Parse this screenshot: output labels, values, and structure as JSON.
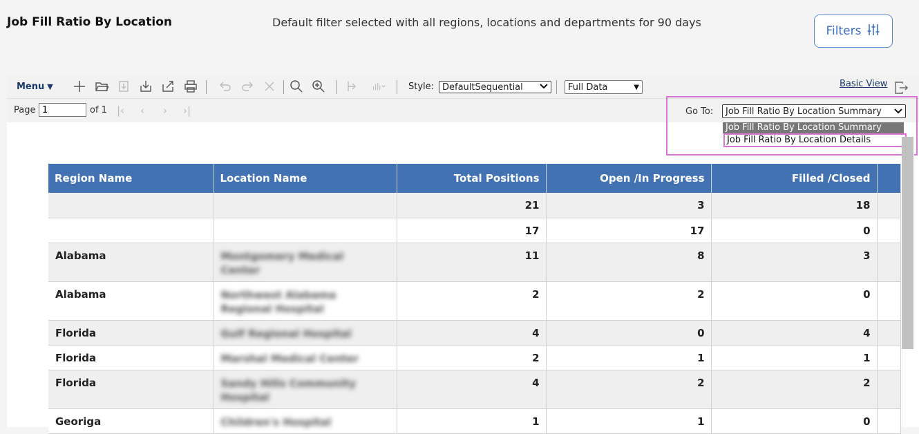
{
  "header": {
    "title": "Job Fill Ratio By Location",
    "subtitle": "Default filter selected with all regions, locations and departments for 90 days",
    "filters_label": "Filters"
  },
  "toolbar": {
    "menu_label": "Menu",
    "style_label": "Style:",
    "style_value": "DefaultSequential",
    "data_value": "Full Data",
    "basic_view_label": "Basic View"
  },
  "pager": {
    "page_label": "Page",
    "page_value": "1",
    "of_label": "of 1"
  },
  "goto": {
    "label": "Go To:",
    "selected": "Job Fill Ratio By Location Summary",
    "options": [
      "Job Fill Ratio By Location Summary",
      "Job Fill Ratio By Location Details"
    ]
  },
  "table": {
    "columns": [
      "Region Name",
      "Location Name",
      "Total Positions",
      "Open /In Progress",
      "Filled /Closed"
    ],
    "rows": [
      {
        "region": "",
        "location": "",
        "total": "21",
        "open": "3",
        "filled": "18"
      },
      {
        "region": "",
        "location": "",
        "total": "17",
        "open": "17",
        "filled": "0"
      },
      {
        "region": "Alabama",
        "location": "Montgomery Medical Center",
        "total": "11",
        "open": "8",
        "filled": "3"
      },
      {
        "region": "Alabama",
        "location": "Northwest Alabama Regional Hospital",
        "total": "2",
        "open": "2",
        "filled": "0"
      },
      {
        "region": "Florida",
        "location": "Gulf Regional Hospital",
        "total": "4",
        "open": "0",
        "filled": "4"
      },
      {
        "region": "Florida",
        "location": "Marshal Medical Center",
        "total": "2",
        "open": "1",
        "filled": "1"
      },
      {
        "region": "Florida",
        "location": "Sandy Hills Community Hospital",
        "total": "4",
        "open": "2",
        "filled": "2"
      },
      {
        "region": "Georiga",
        "location": "Children's Hospital",
        "total": "1",
        "open": "1",
        "filled": "0"
      }
    ]
  },
  "colors": {
    "header_bg": "#4372b3",
    "highlight": "#d774d4",
    "link": "#1a3a6b"
  }
}
